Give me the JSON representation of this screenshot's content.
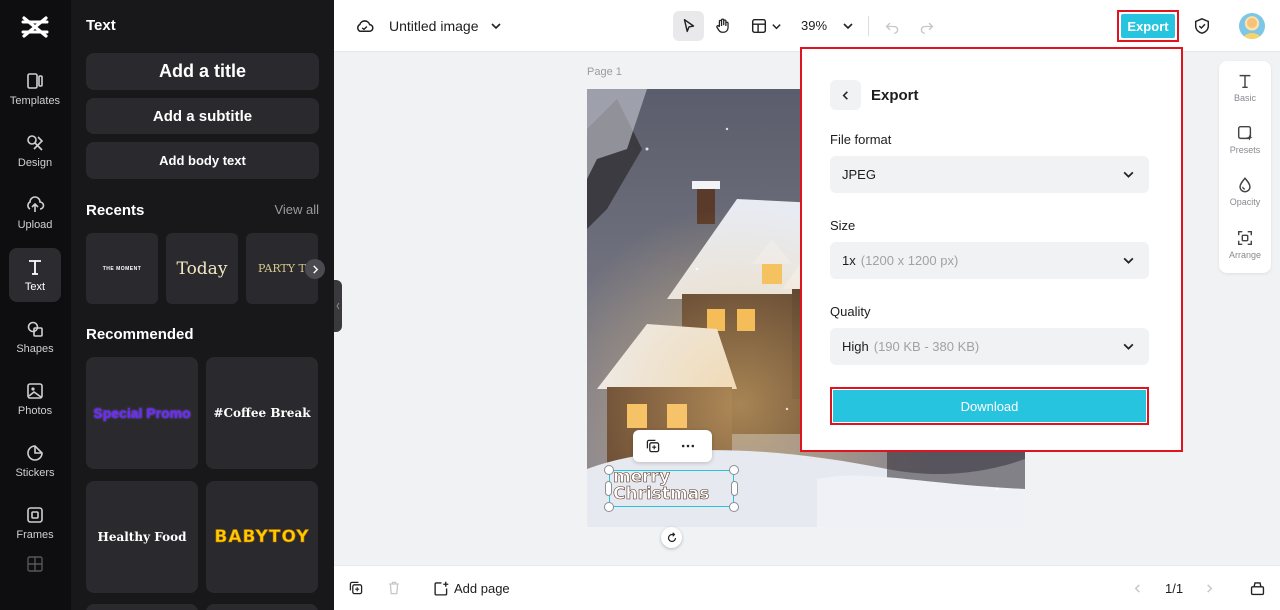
{
  "rail": {
    "items": [
      {
        "label": "Templates",
        "icon": "templates-icon"
      },
      {
        "label": "Design",
        "icon": "design-icon"
      },
      {
        "label": "Upload",
        "icon": "upload-icon"
      },
      {
        "label": "Text",
        "icon": "text-icon"
      },
      {
        "label": "Shapes",
        "icon": "shapes-icon"
      },
      {
        "label": "Photos",
        "icon": "photos-icon"
      },
      {
        "label": "Stickers",
        "icon": "stickers-icon"
      },
      {
        "label": "Frames",
        "icon": "frames-icon"
      }
    ]
  },
  "panel": {
    "heading": "Text",
    "add_title": "Add a title",
    "add_subtitle": "Add a subtitle",
    "add_body": "Add body text",
    "recents_label": "Recents",
    "view_all": "View all",
    "recents": [
      "THE MOMENT",
      "Today",
      "PARTY TONIGHT"
    ],
    "recommended_label": "Recommended",
    "recommended": [
      "Special Promo",
      "#Coffee Break",
      "Healthy Food",
      "BABYTOY"
    ]
  },
  "topbar": {
    "doc_title": "Untitled image",
    "zoom": "39%",
    "export_label": "Export"
  },
  "canvas": {
    "page_label": "Page 1",
    "text_line1": "merry",
    "text_line2": "Christmas"
  },
  "right_toolbar": {
    "items": [
      "Basic",
      "Presets",
      "Opacity",
      "Arrange"
    ]
  },
  "export_dialog": {
    "title": "Export",
    "file_format_label": "File format",
    "file_format_value": "JPEG",
    "size_label": "Size",
    "size_value": "1x",
    "size_detail": "(1200 x 1200 px)",
    "quality_label": "Quality",
    "quality_value": "High",
    "quality_detail": "(190 KB - 380 KB)",
    "download_label": "Download"
  },
  "bottombar": {
    "add_page": "Add page",
    "page_count": "1/1"
  },
  "colors": {
    "accent": "#27c4df",
    "highlight_outline": "#e0141e",
    "rail_bg": "#0e0e10",
    "panel_bg": "#18181b"
  }
}
